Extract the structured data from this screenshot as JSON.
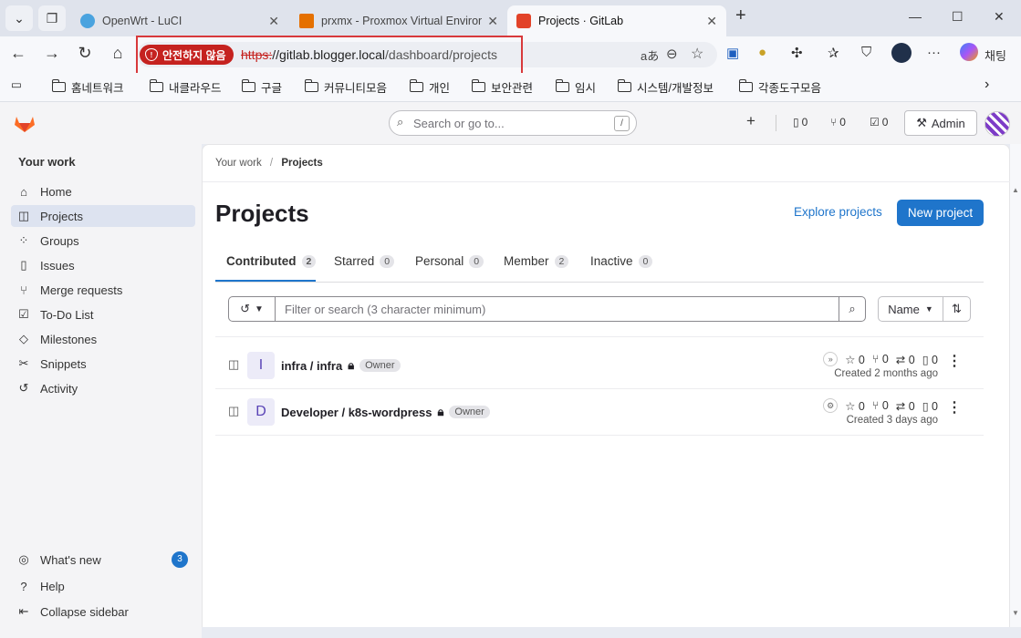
{
  "browser": {
    "tabs": [
      {
        "title": "OpenWrt - LuCI",
        "fav_color": "#4aa3df"
      },
      {
        "title": "prxmx - Proxmox Virtual Environm",
        "fav_color": "#e57000"
      },
      {
        "title": "Projects · GitLab",
        "fav_color": "#e24329"
      }
    ],
    "security_label": "안전하지 않음",
    "url_proto": "https:",
    "url_host": "//gitlab.blogger.local",
    "url_path": "/dashboard/projects",
    "chat_label": "채팅",
    "bookmarks": [
      "홈네트워크",
      "내클라우드",
      "구글",
      "커뮤니티모음",
      "개인",
      "보안관련",
      "임시",
      "시스템/개발정보",
      "각종도구모음"
    ]
  },
  "gitlab": {
    "search_placeholder": "Search or go to...",
    "search_key": "/",
    "counts": {
      "issues": "0",
      "mrs": "0",
      "todos": "0"
    },
    "admin_label": "Admin",
    "sidebar": {
      "section": "Your work",
      "items": [
        {
          "label": "Home",
          "icon": "home-icon"
        },
        {
          "label": "Projects",
          "icon": "project-icon"
        },
        {
          "label": "Groups",
          "icon": "group-icon"
        },
        {
          "label": "Issues",
          "icon": "issues-icon"
        },
        {
          "label": "Merge requests",
          "icon": "merge-request-icon"
        },
        {
          "label": "To-Do List",
          "icon": "todo-icon"
        },
        {
          "label": "Milestones",
          "icon": "milestone-icon"
        },
        {
          "label": "Snippets",
          "icon": "snippet-icon"
        },
        {
          "label": "Activity",
          "icon": "history-icon"
        }
      ],
      "whats_new": "What's new",
      "whats_new_count": "3",
      "help": "Help",
      "collapse": "Collapse sidebar"
    },
    "breadcrumb": {
      "parent": "Your work",
      "current": "Projects"
    },
    "page_title": "Projects",
    "explore_label": "Explore projects",
    "new_project_label": "New project",
    "tabs": [
      {
        "label": "Contributed",
        "count": "2"
      },
      {
        "label": "Starred",
        "count": "0"
      },
      {
        "label": "Personal",
        "count": "0"
      },
      {
        "label": "Member",
        "count": "2"
      },
      {
        "label": "Inactive",
        "count": "0"
      }
    ],
    "filter_placeholder": "Filter or search (3 character minimum)",
    "sort_label": "Name",
    "projects": [
      {
        "avatar": "I",
        "name": "infra / infra",
        "role": "Owner",
        "stars": "0",
        "forks": "0",
        "mrs": "0",
        "issues": "0",
        "created": "Created 2 months ago"
      },
      {
        "avatar": "D",
        "name": "Developer / k8s-wordpress",
        "role": "Owner",
        "stars": "0",
        "forks": "0",
        "mrs": "0",
        "issues": "0",
        "created": "Created 3 days ago"
      }
    ]
  }
}
